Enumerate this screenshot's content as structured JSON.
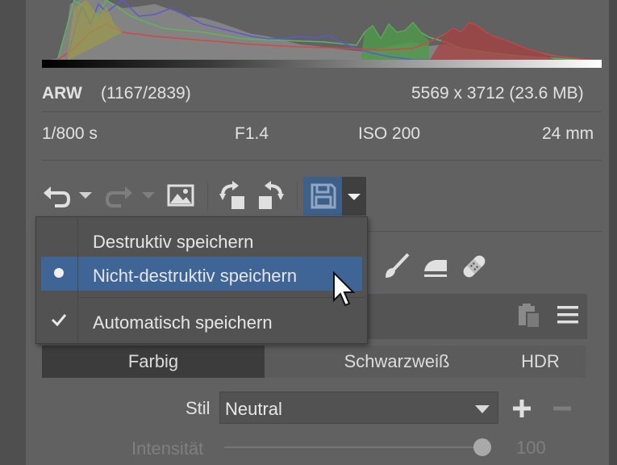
{
  "file_info": {
    "format": "ARW",
    "position": "(1167/2839)",
    "dimensions": "5569 x 3712 (23.6 MB)"
  },
  "exif": {
    "shutter": "1/800 s",
    "aperture": "F1.4",
    "iso": "ISO 200",
    "focal_length": "24 mm"
  },
  "toolbar": {
    "icons": [
      "undo-icon",
      "undo-dropdown-icon",
      "redo-icon",
      "redo-dropdown-icon",
      "image-icon",
      "rotate-left-icon",
      "rotate-right-icon",
      "save-icon",
      "save-dropdown-icon"
    ]
  },
  "save_menu": {
    "items": [
      {
        "label": "Destruktiv speichern",
        "marker": ""
      },
      {
        "label": "Nicht-destruktiv speichern",
        "marker": "bullet",
        "highlighted": true
      },
      {
        "label": "Automatisch speichern",
        "marker": "check"
      }
    ]
  },
  "tools": {
    "icons": [
      "brush-icon",
      "iron-icon",
      "bandage-icon"
    ]
  },
  "section": {
    "icons": [
      "paste-icon",
      "menu-icon"
    ]
  },
  "color_tabs": {
    "items": [
      "Farbig",
      "Schwarzweiß",
      "HDR"
    ],
    "active": "Farbig"
  },
  "style": {
    "label": "Stil",
    "value": "Neutral"
  },
  "intensity": {
    "label": "Intensität",
    "value": "100"
  },
  "colors": {
    "accent": "#3f6596",
    "panel": "#616161",
    "menu_bg": "#525252"
  }
}
